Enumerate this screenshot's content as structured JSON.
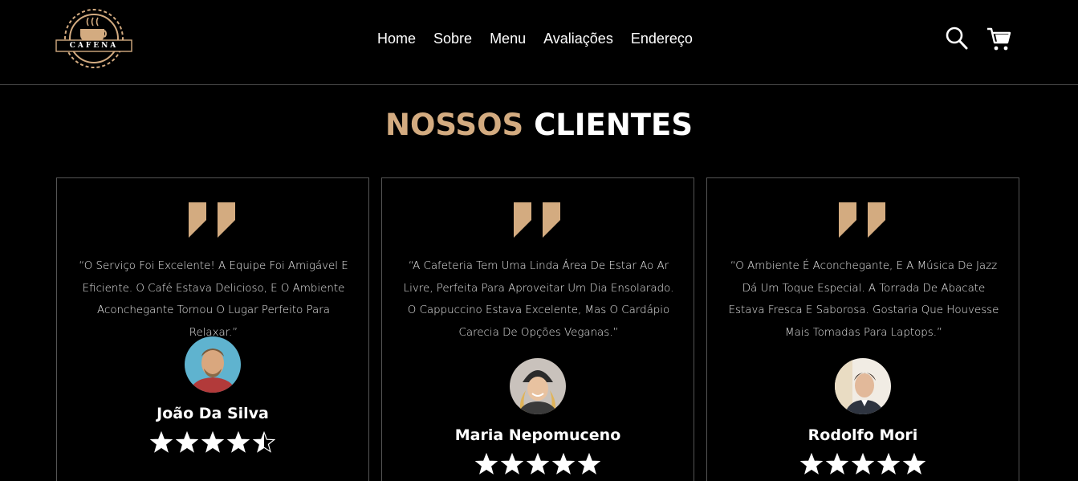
{
  "brand": {
    "logo_text": "CAFENA"
  },
  "nav": {
    "items": [
      "Home",
      "Sobre",
      "Menu",
      "Avaliações",
      "Endereço"
    ]
  },
  "icons": {
    "search": "search-icon",
    "cart": "cart-icon"
  },
  "colors": {
    "accent": "#d3ab80",
    "background": "#000000",
    "text": "#ffffff",
    "border": "#555555"
  },
  "section": {
    "title_accent": "NOSSOS",
    "title_rest": "CLIENTES"
  },
  "testimonials": [
    {
      "review": "“O Serviço Foi Excelente! A Equipe Foi Amigável E Eficiente. O Café Estava Delicioso, E O Ambiente Aconchegante Tornou O Lugar Perfeito Para Relaxar.”",
      "name": "João Da Silva",
      "rating": 4.5
    },
    {
      "review": "“A Cafeteria Tem Uma Linda Área De Estar Ao Ar Livre, Perfeita Para Aproveitar Um Dia Ensolarado. O Cappuccino Estava Excelente, Mas O Cardápio Carecia De Opções Veganas.”",
      "name": "Maria Nepomuceno",
      "rating": 5
    },
    {
      "review": "“O Ambiente É Aconchegante, E A Música De Jazz Dá Um Toque Especial. A Torrada De Abacate Estava Fresca E Saborosa. Gostaria Que Houvesse Mais Tomadas Para Laptops.”",
      "name": "Rodolfo Mori",
      "rating": 5
    }
  ]
}
